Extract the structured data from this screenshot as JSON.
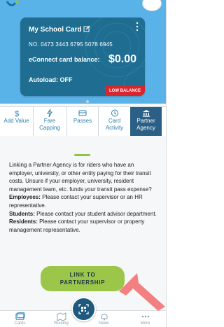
{
  "card": {
    "title": "My School Card",
    "number": "NO. 0473 3443 6795 5078 6945",
    "balance_label": "eConnect card balance:",
    "balance_value": "$0.00",
    "autoload": "Autoload:  OFF",
    "low_balance": "LOW BALANCE"
  },
  "carousel": {
    "total": 2,
    "active": 1
  },
  "tabs": [
    {
      "label1": "Add Value",
      "label2": "",
      "icon": "dollar-icon"
    },
    {
      "label1": "Fare",
      "label2": "Capping",
      "icon": "lightning-icon"
    },
    {
      "label1": "Passes",
      "label2": "",
      "icon": "pass-icon"
    },
    {
      "label1": "Card",
      "label2": "Activity",
      "icon": "clock-icon"
    },
    {
      "label1": "Partner",
      "label2": "Agency",
      "icon": "bank-icon"
    }
  ],
  "info": {
    "intro": "Linking a Partner Agency is for riders who have an employer, university, or other entity paying for their transit costs. Unsure if your employer, university, resident management team, etc. funds your transit pass expense?",
    "employees_label": "Employees:",
    "employees_text": " Please contact your supervisor or an HR representative.",
    "students_label": "Students:",
    "students_text": " Please contact your student advisor department.",
    "residents_label": "Residents:",
    "residents_text": " Please contact your supervisor or property management representative."
  },
  "link_button": {
    "line1": "LINK TO",
    "line2": "PARTNERSHIP"
  },
  "bottom_nav": [
    {
      "label": "Cards",
      "icon": "cards-icon"
    },
    {
      "label": "Routing",
      "icon": "map-icon"
    },
    {
      "label": "News",
      "icon": "bell-icon"
    },
    {
      "label": "More",
      "icon": "more-icon"
    }
  ],
  "colors": {
    "header": "#5ab3e8",
    "card": "#1f6e92",
    "active_tab": "#2b5f85",
    "button": "#9bc64a",
    "low_balance": "#d7262e",
    "arrow": "#f28080"
  }
}
